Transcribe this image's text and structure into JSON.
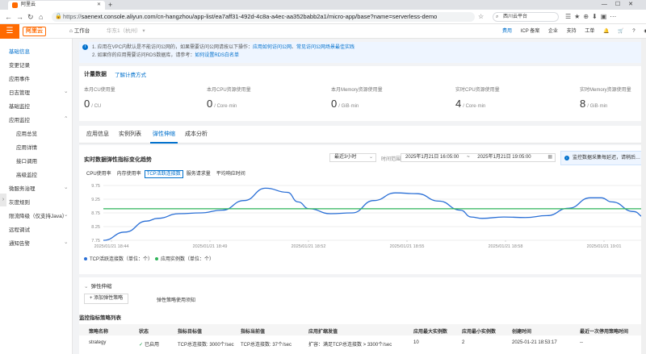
{
  "browser": {
    "tab_title": "阿里云",
    "url_scheme": "https://",
    "url_rest": "saenext.console.aliyun.com/cn-hangzhou/app-list/ea7aff31-492d-4c8a-a4ec-aa352babb2a1/micro-app/base?name=serverless-demo",
    "search_placeholder": "西川云平台"
  },
  "topbar": {
    "logo": "阿里云",
    "workspace": "工作台",
    "region": "华东1（杭州）",
    "nav": [
      "费用",
      "ICP 备案",
      "企业",
      "支持",
      "工单"
    ]
  },
  "sidebar": {
    "items": [
      {
        "label": "基础信息",
        "active": true,
        "sub": false,
        "caret": false
      },
      {
        "label": "变更记录",
        "active": false,
        "sub": false,
        "caret": false
      },
      {
        "label": "应用事件",
        "active": false,
        "sub": false,
        "caret": false
      },
      {
        "label": "日志管理",
        "active": false,
        "sub": false,
        "caret": true
      },
      {
        "label": "基础监控",
        "active": false,
        "sub": false,
        "caret": false
      },
      {
        "label": "应用监控",
        "active": false,
        "sub": false,
        "caret": true
      },
      {
        "label": "应用总览",
        "active": false,
        "sub": true,
        "caret": false
      },
      {
        "label": "应用详情",
        "active": false,
        "sub": true,
        "caret": false
      },
      {
        "label": "接口调用",
        "active": false,
        "sub": true,
        "caret": false
      },
      {
        "label": "高级监控",
        "active": false,
        "sub": true,
        "caret": false
      },
      {
        "label": "微服务治理",
        "active": false,
        "sub": false,
        "caret": true
      },
      {
        "label": "灰度规则",
        "active": false,
        "sub": false,
        "caret": false
      },
      {
        "label": "限流降级（仅支持Java）",
        "active": false,
        "sub": false,
        "caret": true
      },
      {
        "label": "远程调试",
        "active": false,
        "sub": false,
        "caret": false
      },
      {
        "label": "通知告警",
        "active": false,
        "sub": false,
        "caret": true
      }
    ]
  },
  "notice": {
    "line1_text": "1. 应用在VPC内默认是不能访问公网的，如果需要访问公网请按以下操作：",
    "line1_link1": "应用如何访问公网",
    "line1_sep": "、",
    "line1_link2": "常见访问公网场景最佳实践",
    "line2_text": "2. 如果你的应用需要访问RDS数据库，请参考：",
    "line2_link": "如何设置RDS白名单"
  },
  "metrics": {
    "title": "计量数据",
    "link": "了解计费方式",
    "items": [
      {
        "label": "本月CU使用量",
        "value": "0",
        "unit": "/ CU"
      },
      {
        "label": "本月CPU资源使用量",
        "value": "0",
        "unit": "/ Core·min"
      },
      {
        "label": "本月Memory资源使用量",
        "value": "0",
        "unit": "/ GiB·min"
      },
      {
        "label": "实时CPU资源使用量",
        "value": "4",
        "unit": "/ Core·min"
      },
      {
        "label": "实时Memory资源使用量",
        "value": "8",
        "unit": "/ GiB·min"
      }
    ]
  },
  "tabs": [
    {
      "label": "应用信息",
      "active": false
    },
    {
      "label": "实例列表",
      "active": false
    },
    {
      "label": "弹性伸缩",
      "active": true
    },
    {
      "label": "成本分析",
      "active": false
    }
  ],
  "chart_section": {
    "title": "实时数据弹性指标变化趋势",
    "range_select": "最近3小时",
    "range_label": "时间范围",
    "time_start": "2025年1月21日 16:05:00",
    "time_sep": "~",
    "time_end": "2025年1月21日 19:05:00",
    "alert": "监控数据采集每延迟，请稍后…",
    "subtabs": [
      {
        "label": "CPU使用率",
        "active": false
      },
      {
        "label": "内存使用率",
        "active": false
      },
      {
        "label": "TCP活跃连接数",
        "active": true
      },
      {
        "label": "服务请求量",
        "active": false
      },
      {
        "label": "平均响应时间",
        "active": false
      }
    ]
  },
  "chart_data": {
    "type": "line",
    "ylim": [
      7.75,
      9.75
    ],
    "yticks": [
      "9.75",
      "9.25",
      "8.75",
      "8.25",
      "7.75"
    ],
    "xticks": [
      "2025/01/21 18:44",
      "2025/01/21 18:49",
      "2025/01/21 18:52",
      "2025/01/21 18:55",
      "2025/01/21 18:58",
      "2025/01/21 19:01"
    ],
    "x": [
      0,
      0.04,
      0.08,
      0.1,
      0.14,
      0.18,
      0.22,
      0.26,
      0.3,
      0.34,
      0.36,
      0.38,
      0.42,
      0.46,
      0.5,
      0.54,
      0.58,
      0.62,
      0.66,
      0.68,
      0.7,
      0.74,
      0.78,
      0.82,
      0.86,
      0.9,
      0.92,
      0.94,
      0.98,
      1.0
    ],
    "series": [
      {
        "name": "TCP活跃连接数（单位：个）",
        "color": "#2a6fd6",
        "values": [
          7.75,
          8.05,
          8.45,
          8.55,
          8.72,
          8.75,
          8.85,
          9.2,
          9.65,
          9.5,
          9.15,
          8.9,
          8.72,
          8.75,
          9.2,
          9.48,
          9.45,
          9.18,
          8.85,
          8.6,
          8.55,
          8.6,
          8.58,
          8.65,
          8.92,
          9.3,
          9.3,
          9.15,
          8.8,
          8.6
        ]
      },
      {
        "name": "应用实例数（单位：个）",
        "color": "#2fb45a",
        "values": [
          8.9,
          8.9,
          8.9,
          8.9,
          8.9,
          8.9,
          8.9,
          8.9,
          8.9,
          8.9,
          8.9,
          8.9,
          8.9,
          8.9,
          8.9,
          8.9,
          8.9,
          8.9,
          8.9,
          8.9,
          8.9,
          8.9,
          8.9,
          8.9,
          8.9,
          8.9,
          8.9,
          8.9,
          8.9,
          8.9
        ]
      }
    ],
    "legend": "bottom-left",
    "grid": true
  },
  "elastic": {
    "title": "弹性伸缩",
    "add_button": "+ 添加弹性策略",
    "usage_link": "弹性策略使用须知",
    "list_title": "监控指标策略列表",
    "columns": [
      "策略名称",
      "状态",
      "指标目标值",
      "指标当前值",
      "应用扩缩发值",
      "应用最大实例数",
      "应用最小实例数",
      "创建时间",
      "最近一次停用策略时间",
      "操作"
    ],
    "rows": [
      [
        "strategy",
        "已启用",
        "TCP总连接数: 3000个/sec",
        "TCP总连接数: 37个/sec",
        "扩容：满足TCP总连接数 > 3300个/sec",
        "10",
        "2",
        "2025-01-21 18:53:17",
        "--",
        "编辑"
      ]
    ]
  }
}
